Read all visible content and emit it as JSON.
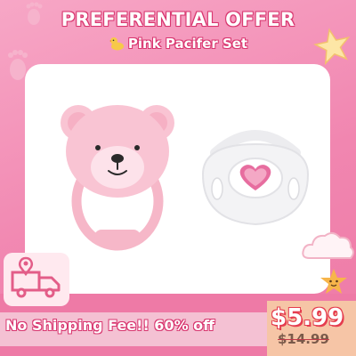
{
  "banner": {
    "title": "PREFERENTIAL OFFER",
    "subtitle": "Pink Pacifer Set"
  },
  "footer": {
    "shipping": "No Shipping Fee!!  60% off",
    "price_new": "$5.99",
    "price_old": "$14.99"
  },
  "colors": {
    "background": "#f184ad",
    "panel": "#ffffff",
    "text_outline": "#d8366f",
    "price_outline": "#e53d4f",
    "bear_pink": "#f9c4d3",
    "pacifier_white": "#f3f3f5",
    "heart_pink": "#e76d9f"
  },
  "icons": [
    "duck-icon",
    "delivery-truck-icon",
    "location-pin-icon",
    "star-icon",
    "cloud-icon",
    "star-face-icon",
    "baby-footprint-icon"
  ]
}
